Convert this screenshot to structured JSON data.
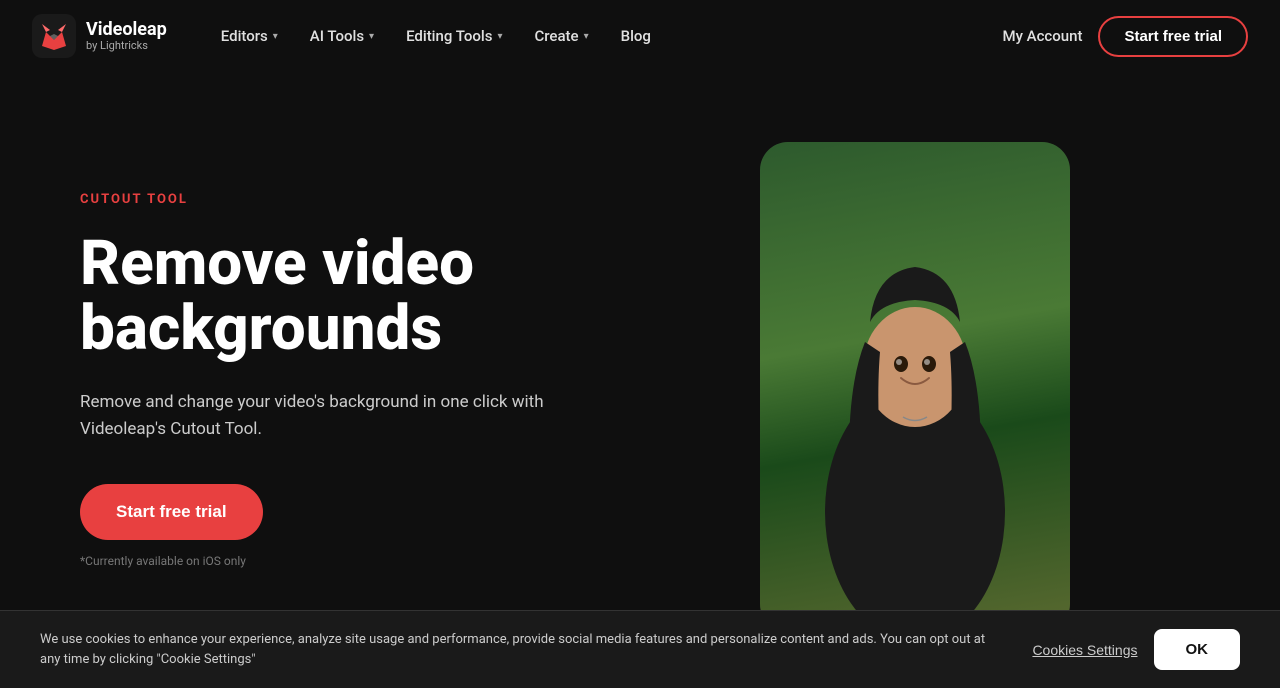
{
  "brand": {
    "title": "Videoleap",
    "subtitle": "by Lightricks"
  },
  "nav": {
    "items": [
      {
        "label": "Editors",
        "has_dropdown": true
      },
      {
        "label": "AI Tools",
        "has_dropdown": true
      },
      {
        "label": "Editing Tools",
        "has_dropdown": true
      },
      {
        "label": "Create",
        "has_dropdown": true
      },
      {
        "label": "Blog",
        "has_dropdown": false
      }
    ],
    "account_label": "My Account",
    "cta_label": "Start free trial"
  },
  "hero": {
    "tag": "CUTOUT TOOL",
    "title": "Remove video backgrounds",
    "description": "Remove and change your video's background in one click with Videoleap's Cutout Tool.",
    "cta_label": "Start free trial",
    "ios_note": "*Currently available on iOS only"
  },
  "cookie": {
    "text": "We use cookies to enhance your experience, analyze site usage and performance, provide social media features and personalize content and ads. You can opt out at any time by clicking \"Cookie Settings\"",
    "settings_label": "Cookies Settings",
    "ok_label": "OK"
  },
  "colors": {
    "accent": "#e84040",
    "bg": "#0f0f0f"
  }
}
